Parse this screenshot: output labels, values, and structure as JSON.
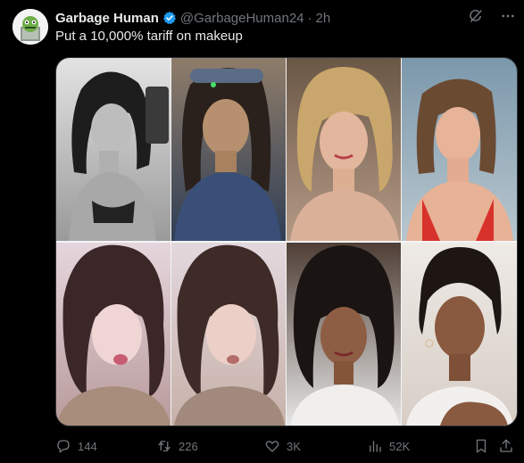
{
  "post": {
    "author_name": "Garbage Human",
    "handle": "@GarbageHuman24",
    "separator": "·",
    "time": "2h",
    "text": "Put a 10,000% tariff on makeup"
  },
  "media": {
    "tiles": [
      {
        "name": "photo-1-makeup",
        "bg": "#cfcfcf"
      },
      {
        "name": "photo-1-nomakeup",
        "bg": "#7b6a5c"
      },
      {
        "name": "photo-2-makeup",
        "bg": "#5b4b3e"
      },
      {
        "name": "photo-2-nomakeup",
        "bg": "#9cb0bd"
      },
      {
        "name": "photo-3-makeup",
        "bg": "#d9c9cf"
      },
      {
        "name": "photo-3-nomakeup",
        "bg": "#d3c3c8"
      },
      {
        "name": "photo-4-makeup",
        "bg": "#3a2e2a"
      },
      {
        "name": "photo-4-nomakeup",
        "bg": "#d9d2cc"
      }
    ]
  },
  "actions": {
    "replies": "144",
    "reposts": "226",
    "likes": "3K",
    "views": "52K"
  },
  "colors": {
    "background": "#000000",
    "text": "#e7e9ea",
    "muted": "#71767b",
    "verified": "#1d9bf0"
  }
}
